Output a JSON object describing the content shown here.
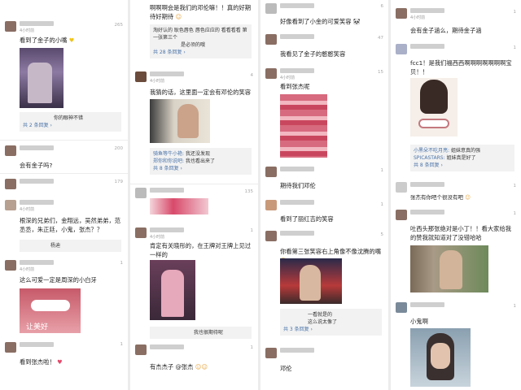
{
  "c1": {
    "likes": [
      "265",
      "200",
      "179",
      "1",
      "1",
      "1"
    ],
    "time": "4小时前",
    "t1": "看到了金子的小嘴",
    "sub1": "你的眼神不错",
    "more1": "共 2 条回复 ›",
    "t2": "会有金子吗?",
    "t3": "根深的兄弟们，金翔远，吴然弟弟，范丞丞，朱正廷，小鬼，张杰？？",
    "sub3": "杨迪",
    "t4": "这么可爱一定是周深的小白牙",
    "img4": "让美好",
    "t5": "看到张杰啦！"
  },
  "c2": {
    "t0": "啊啊啊会是我们的邓伦嘛！！真的好期待好期待",
    "sub0": "淘好认的 耿色唇色 唇色应应的 看看看看 第一张第三个",
    "sub0b": "是必须的哦",
    "more0": "共 28 条回复 ›",
    "time": "4小时前",
    "likes": [
      "4",
      "135",
      "1",
      "1"
    ],
    "t1": "我猜的话，这里面一定会有邓伦的笑容",
    "r1a_name": "骑鱼等牛小艳:",
    "r1a": "我还没发现",
    "r1b_name": "郑你和你说吧:",
    "r1b": "我也看出来了",
    "more1": "共 8 条回复 ›",
    "t3": "肯定有关晓彤的，在王牌对王牌上见过一样的",
    "sub3": "我也很期待呢",
    "t4": "有杰杰子 @张杰"
  },
  "c3": {
    "t0": "好像看到了小金的可爱笑容",
    "likes": [
      "6",
      "47",
      "15",
      "1",
      "1",
      "5"
    ],
    "time": "4小时前",
    "t1": "我看见了金子的憨憨笑容",
    "t2": "看到张杰呢",
    "t3": "期待我们邓伦",
    "t4": "看到了丽红吉的笑容",
    "t5": "你看第三张笑容右上角像不像沈腾的嘴",
    "sub5": "一看就是的",
    "sub5b": "这么说太像了",
    "more5": "共 3 条回复 ›",
    "t6": "邓伦"
  },
  "c4": {
    "t0": "会有金子涵么，期待金子涵",
    "likes": [
      "1",
      "1",
      "1",
      "1",
      "1"
    ],
    "time": "4小时前",
    "t1": "fcc1！是我们福西西啊啊啊啊啊啊啊宝贝！！",
    "r1a_name": "小黑朵不吃月亮:",
    "r1a": "姐妹意真的强",
    "r1b_name": "SPICASTARS:",
    "r1b": "姐妹真是好了",
    "more1": "共 8 条回复 ›",
    "t2": "张杰有你吧个很没有吧",
    "t3": "吐西头那张绝对是小丁！！看大家给我的赞我就知道对了没错哈哈",
    "t4": "小鬼啊"
  }
}
